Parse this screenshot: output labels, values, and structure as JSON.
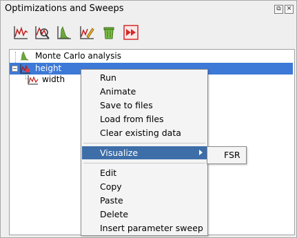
{
  "panel": {
    "title": "Optimizations and Sweeps",
    "title_buttons": [
      {
        "icon": "float-icon",
        "glyph": "⧉"
      },
      {
        "icon": "close-icon",
        "glyph": "✕"
      }
    ]
  },
  "toolbar": {
    "tools": [
      {
        "name": "parameter-sweep-tool",
        "icon": "sweep-plot-icon"
      },
      {
        "name": "optimization-tool",
        "icon": "optimization-icon"
      },
      {
        "name": "monte-carlo-tool",
        "icon": "histogram-icon"
      },
      {
        "name": "edit-tool",
        "icon": "pencil-plot-icon"
      },
      {
        "name": "delete-tool",
        "icon": "trash-icon"
      },
      {
        "name": "run-all-tool",
        "icon": "fast-forward-icon"
      }
    ]
  },
  "tree": {
    "items": [
      {
        "label": "Monte Carlo analysis",
        "icon": "histogram-icon",
        "selected": false
      },
      {
        "label": "height",
        "icon": "sweep-plot-icon",
        "selected": true,
        "expander": "−"
      },
      {
        "label": "width",
        "icon": "sweep-plot-icon",
        "selected": false
      }
    ]
  },
  "context_menu": {
    "items": [
      "Run",
      "Animate",
      "Save to files",
      "Load from files",
      "Clear existing data"
    ],
    "visualize": "Visualize",
    "items2": [
      "Edit",
      "Copy",
      "Paste",
      "Delete",
      "Insert parameter sweep"
    ],
    "submenu": {
      "items": [
        "FSR"
      ]
    }
  },
  "colors": {
    "selection": "#3d79d6",
    "menu_highlight": "#3e6ea8"
  }
}
